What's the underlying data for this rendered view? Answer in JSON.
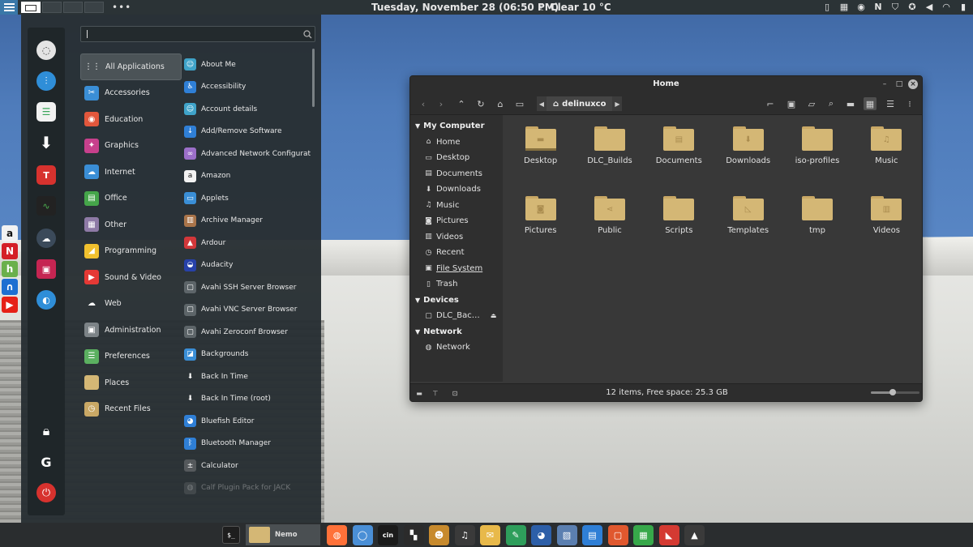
{
  "top_panel": {
    "clock": "Tuesday, November 28 (06:50 PM)",
    "weather": "Clear 10 °C",
    "more": "•••",
    "tray_icons": [
      "clipboard-icon",
      "calendar-icon",
      "bulb-icon",
      "notion-icon",
      "shield-icon",
      "vpn-icon",
      "volume-icon",
      "wifi-icon",
      "battery-icon"
    ]
  },
  "side_dock": {
    "apps": [
      {
        "name": "amazon",
        "glyph": "a",
        "color": "#f2f2f2",
        "fg": "#111"
      },
      {
        "name": "netflix",
        "glyph": "N",
        "color": "#d41f26",
        "fg": "#fff"
      },
      {
        "name": "hulu",
        "glyph": "h",
        "color": "#6ab04c",
        "fg": "#fff"
      },
      {
        "name": "disney",
        "glyph": "∩",
        "color": "#1d6fd1",
        "fg": "#fff"
      },
      {
        "name": "youtube",
        "glyph": "▶",
        "color": "#e62117",
        "fg": "#fff"
      }
    ]
  },
  "menu": {
    "search_value": "",
    "categories": [
      {
        "label": "All Applications",
        "color": "#4b5357",
        "glyph": "⋮⋮"
      },
      {
        "label": "Accessories",
        "color": "#3a8ed6",
        "glyph": "✂"
      },
      {
        "label": "Education",
        "color": "#e2573c",
        "glyph": "◉"
      },
      {
        "label": "Graphics",
        "color": "#c7408c",
        "glyph": "✦"
      },
      {
        "label": "Internet",
        "color": "#3a8ed6",
        "glyph": "☁"
      },
      {
        "label": "Office",
        "color": "#45a54a",
        "glyph": "▤"
      },
      {
        "label": "Other",
        "color": "#8e7aa6",
        "glyph": "▦"
      },
      {
        "label": "Programming",
        "color": "#f2c12e",
        "glyph": "◢"
      },
      {
        "label": "Sound & Video",
        "color": "#e53935",
        "glyph": "▶"
      },
      {
        "label": "Web",
        "color": "transparent",
        "glyph": "☁"
      },
      {
        "label": "Administration",
        "color": "#7c8387",
        "glyph": "▣"
      },
      {
        "label": "Preferences",
        "color": "#5bb060",
        "glyph": "☰"
      },
      {
        "label": "Places",
        "color": "#d4b775",
        "glyph": ""
      },
      {
        "label": "Recent Files",
        "color": "#c9a865",
        "glyph": "◷"
      }
    ],
    "apps": [
      {
        "label": "About Me",
        "color": "#3fa3c9",
        "glyph": "☺"
      },
      {
        "label": "Accessibility",
        "color": "#2f7fd6",
        "glyph": "♿"
      },
      {
        "label": "Account details",
        "color": "#3fa3c9",
        "glyph": "☺"
      },
      {
        "label": "Add/Remove Software",
        "color": "#2f7fd6",
        "glyph": "↓"
      },
      {
        "label": "Advanced Network Configurat…",
        "color": "#9b6fc9",
        "glyph": "∞"
      },
      {
        "label": "Amazon",
        "color": "#f2f2f2",
        "glyph": "a"
      },
      {
        "label": "Applets",
        "color": "#3a8ed6",
        "glyph": "▭"
      },
      {
        "label": "Archive Manager",
        "color": "#a9744a",
        "glyph": "▥"
      },
      {
        "label": "Ardour",
        "color": "#d2373a",
        "glyph": "▲"
      },
      {
        "label": "Audacity",
        "color": "#2741a8",
        "glyph": "◒"
      },
      {
        "label": "Avahi SSH Server Browser",
        "color": "#5d6569",
        "glyph": "▢"
      },
      {
        "label": "Avahi VNC Server Browser",
        "color": "#5d6569",
        "glyph": "▢"
      },
      {
        "label": "Avahi Zeroconf Browser",
        "color": "#5d6569",
        "glyph": "▢"
      },
      {
        "label": "Backgrounds",
        "color": "#3a8ed6",
        "glyph": "◪"
      },
      {
        "label": "Back In Time",
        "color": "transparent",
        "glyph": "⬇"
      },
      {
        "label": "Back In Time (root)",
        "color": "transparent",
        "glyph": "⬇"
      },
      {
        "label": "Bluefish Editor",
        "color": "#2f7fd6",
        "glyph": "◕"
      },
      {
        "label": "Bluetooth Manager",
        "color": "#2f7fd6",
        "glyph": "ᛒ"
      },
      {
        "label": "Calculator",
        "color": "#55595c",
        "glyph": "±"
      },
      {
        "label": "Calf Plugin Pack for JACK",
        "color": "#6a6e70",
        "glyph": "◍"
      }
    ]
  },
  "nemo": {
    "title": "Home",
    "path": "delinuxco",
    "sidebar": {
      "my_computer": "My Computer",
      "places": [
        "Home",
        "Desktop",
        "Documents",
        "Downloads",
        "Music",
        "Pictures",
        "Videos",
        "Recent",
        "File System",
        "Trash"
      ],
      "devices": "Devices",
      "device_items": [
        "DLC_Bac…"
      ],
      "network": "Network",
      "network_items": [
        "Network"
      ]
    },
    "files": [
      {
        "label": "Desktop",
        "sym": "▬"
      },
      {
        "label": "DLC_Builds",
        "sym": ""
      },
      {
        "label": "Documents",
        "sym": "▤"
      },
      {
        "label": "Downloads",
        "sym": "⬇"
      },
      {
        "label": "iso-profiles",
        "sym": ""
      },
      {
        "label": "Music",
        "sym": "♫"
      },
      {
        "label": "Pictures",
        "sym": "◙"
      },
      {
        "label": "Public",
        "sym": "⋖"
      },
      {
        "label": "Scripts",
        "sym": ""
      },
      {
        "label": "Templates",
        "sym": "◺"
      },
      {
        "label": "tmp",
        "sym": ""
      },
      {
        "label": "Videos",
        "sym": "▥"
      }
    ],
    "status": "12 items, Free space: 25.3 GB",
    "zoom_level": 0.45
  },
  "bottom_panel": {
    "nemo_label": "Nemo",
    "dock_apps": [
      {
        "name": "firefox",
        "glyph": "◍",
        "color": "#ff7139"
      },
      {
        "name": "chromium",
        "glyph": "◯",
        "color": "#4a8fd6"
      },
      {
        "name": "cinelerra",
        "glyph": "cin",
        "color": "#1b1b1b"
      },
      {
        "name": "clapper",
        "glyph": "▚",
        "color": "#2b2b2b"
      },
      {
        "name": "monkey",
        "glyph": "☻",
        "color": "#c78a2d"
      },
      {
        "name": "music",
        "glyph": "♫",
        "color": "#3a3a3a"
      },
      {
        "name": "mail",
        "glyph": "✉",
        "color": "#e8b94a"
      },
      {
        "name": "writer",
        "glyph": "✎",
        "color": "#2e9e5b"
      },
      {
        "name": "bluefish",
        "glyph": "◕",
        "color": "#2d5fa8"
      },
      {
        "name": "photos",
        "glyph": "▧",
        "color": "#5b7fb0"
      },
      {
        "name": "docs",
        "glyph": "▤",
        "color": "#2f7fd6"
      },
      {
        "name": "impress",
        "glyph": "▢",
        "color": "#e0582e"
      },
      {
        "name": "calc",
        "glyph": "▦",
        "color": "#37a84a"
      },
      {
        "name": "wps",
        "glyph": "◣",
        "color": "#d43a32"
      },
      {
        "name": "inkscape",
        "glyph": "▲",
        "color": "#3a3a3a"
      }
    ]
  }
}
